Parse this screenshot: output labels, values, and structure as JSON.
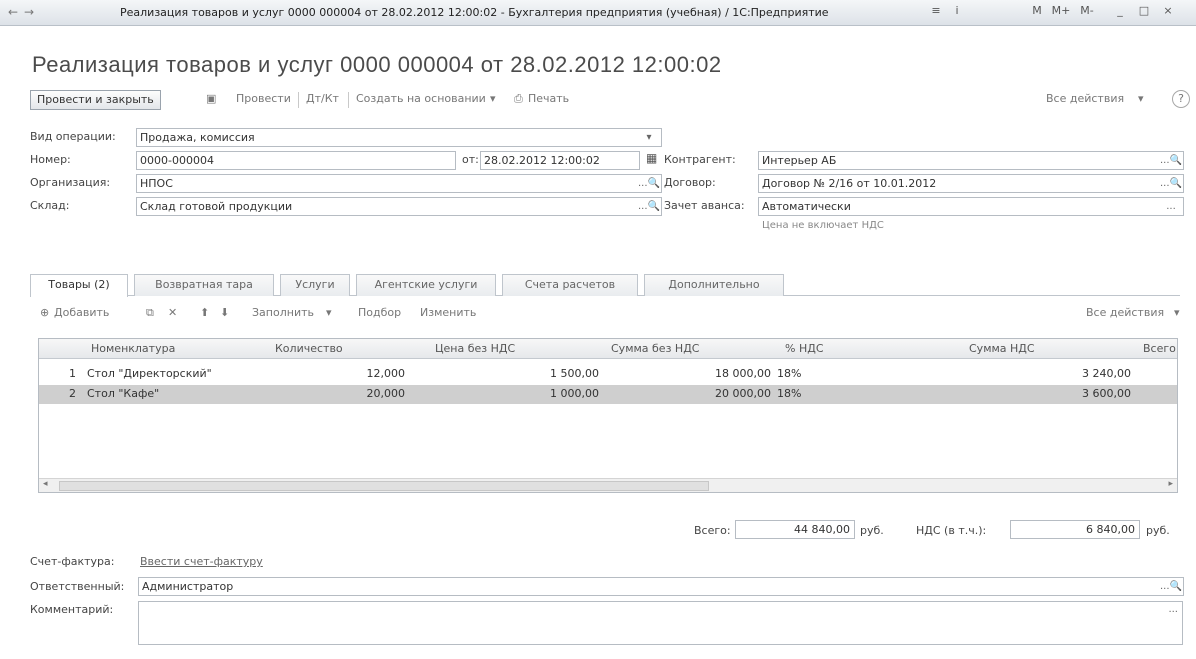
{
  "window": {
    "title": "Реализация товаров и услуг 0000 000004 от 28.02.2012 12:00:02 - Бухгалтерия предприятия (учебная) / 1С:Предприятие",
    "nav_back": "←",
    "nav_forward": "→",
    "controls": [
      "≡",
      "i",
      "M",
      "M+",
      "M-",
      "_",
      "□",
      "×"
    ]
  },
  "document": {
    "title": "Реализация товаров и услуг 0000 000004 от 28.02.2012 12:00:02"
  },
  "toolbar": {
    "post_and_close": "Провести и закрыть",
    "save": "▣",
    "post": "Провести",
    "dt_kt": "Дт/Кт",
    "create_based_on": "Создать на основании",
    "print": "Печать",
    "all_actions": "Все действия",
    "help": "?"
  },
  "form": {
    "operation_label": "Вид операции:",
    "operation_value": "Продажа, комиссия",
    "number_label": "Номер:",
    "number_value": "0000-000004",
    "date_label": "от:",
    "date_value": "28.02.2012 12:00:02",
    "organization_label": "Организация:",
    "organization_value": "НПОС",
    "warehouse_label": "Склад:",
    "warehouse_value": "Склад готовой продукции",
    "counterparty_label": "Контрагент:",
    "counterparty_value": "Интерьер АБ",
    "contract_label": "Договор:",
    "contract_value": "Договор № 2/16 от 10.01.2012",
    "settlement_label": "Зачет аванса:",
    "settlement_value": "Автоматически",
    "prices_note": "Цена не включает НДС"
  },
  "tabs": [
    {
      "label": "Товары (2)"
    },
    {
      "label": "Возвратная тара"
    },
    {
      "label": "Услуги"
    },
    {
      "label": "Агентские услуги"
    },
    {
      "label": "Счета расчетов"
    },
    {
      "label": "Дополнительно"
    }
  ],
  "table_toolbar": {
    "add": "Добавить",
    "fill": "Заполнить",
    "pick": "Подбор",
    "change": "Изменить",
    "all_actions": "Все действия"
  },
  "grid": {
    "columns": [
      "Номенклатура",
      "Количество",
      "Цена без НДС",
      "Сумма без НДС",
      "% НДС",
      "Сумма НДС",
      "Всего"
    ],
    "rows": [
      {
        "n": "1",
        "item": "Стол \"Директорский\"",
        "qty": "12,000",
        "price": "1 500,00",
        "sum": "18 000,00",
        "vat_rate": "18%",
        "vat": "3 240,00"
      },
      {
        "n": "2",
        "item": "Стол \"Кафе\"",
        "qty": "20,000",
        "price": "1 000,00",
        "sum": "20 000,00",
        "vat_rate": "18%",
        "vat": "3 600,00"
      }
    ]
  },
  "totals": {
    "total_label": "Всего:",
    "total_value": "44 840,00",
    "total_currency": "руб.",
    "vat_label": "НДС (в т.ч.):",
    "vat_value": "6 840,00",
    "vat_currency": "руб."
  },
  "footer": {
    "invoice_label": "Счет-фактура:",
    "invoice_link": "Ввести счет-фактуру",
    "responsible_label": "Ответственный:",
    "responsible_value": "Администратор",
    "comment_label": "Комментарий:"
  },
  "colors": {
    "accent": "#4b4b4b",
    "selected_row": "#cfcfcf"
  }
}
